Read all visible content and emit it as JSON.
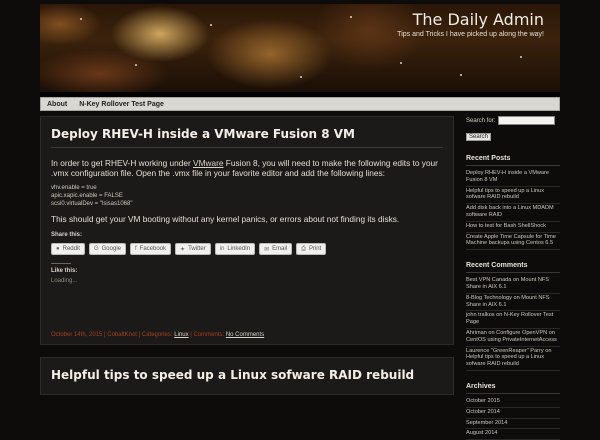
{
  "site": {
    "title": "The Daily Admin",
    "tagline": "Tips and Tricks I have picked up along the way!"
  },
  "nav": [
    "About",
    "N-Key Rollover Test Page"
  ],
  "post1": {
    "title": "Deploy RHEV-H inside a VMware Fusion 8 VM",
    "lead_pre": "In order to get RHEV-H working under ",
    "lead_link": "VMware",
    "lead_post": " Fusion 8, you will need to make the following edits to your .vmx configuration file.  Open the .vmx file in your favorite editor and add the following lines:",
    "code": [
      "vhv.enable = true",
      "apic.xapic.enable = FALSE",
      "scsi0.virtualDev = \"lsisas1068\""
    ],
    "closing": "This should get your VM booting without any kernel panics, or errors about not finding its disks.",
    "share_label": "Share this:",
    "share_buttons": [
      {
        "icon": "reddit-icon",
        "glyph": "●",
        "label": "Reddit"
      },
      {
        "icon": "google-icon",
        "glyph": "G",
        "label": "Google"
      },
      {
        "icon": "facebook-icon",
        "glyph": "f",
        "label": "Facebook"
      },
      {
        "icon": "twitter-icon",
        "glyph": "✦",
        "label": "Twitter"
      },
      {
        "icon": "linkedin-icon",
        "glyph": "in",
        "label": "LinkedIn"
      },
      {
        "icon": "email-icon",
        "glyph": "✉",
        "label": "Email"
      },
      {
        "icon": "print-icon",
        "glyph": "⎙",
        "label": "Print"
      }
    ],
    "like_label": "Like this:",
    "loading": "Loading...",
    "meta_date": "October 14th, 2015",
    "meta_author": "CobaltKnot",
    "meta_cat_label": "Categories:",
    "meta_category": "Linux",
    "meta_comments_label": "Comments:",
    "meta_comments": "No Comments"
  },
  "post2": {
    "title": "Helpful tips to speed up a Linux sofware RAID rebuild"
  },
  "sidebar": {
    "search_label": "Search for:",
    "search_button": "Search",
    "recent_posts_title": "Recent Posts",
    "recent_posts": [
      "Deploy RHEV-H inside a VMware Fusion 8 VM",
      "Helpful tips to speed up a Linux sofware RAID rebuild",
      "Add disk back into a Linux MDADM software RAID",
      "How to test for Bash ShellShock",
      "Create Apple Time Capsule for Time Machine backups using Centos 6.5"
    ],
    "recent_comments_title": "Recent Comments",
    "recent_comments": [
      "Best VPN Canada on Mount NFS Share in AIX 6.1",
      "8-Blog Technology on Mount NFS Share in AIX 6.1",
      "john tralkos on N-Key Rollover Test Page",
      "Ahriman on Configure OpenVPN on CentOS using PrivateInternetAccess",
      "Laurence \"GreenReaper\" Parry on Helpful tips to speed up a Linux sofware RAID rebuild"
    ],
    "archives_title": "Archives",
    "archives": [
      "October 2015",
      "October 2014",
      "September 2014",
      "August 2014"
    ]
  }
}
